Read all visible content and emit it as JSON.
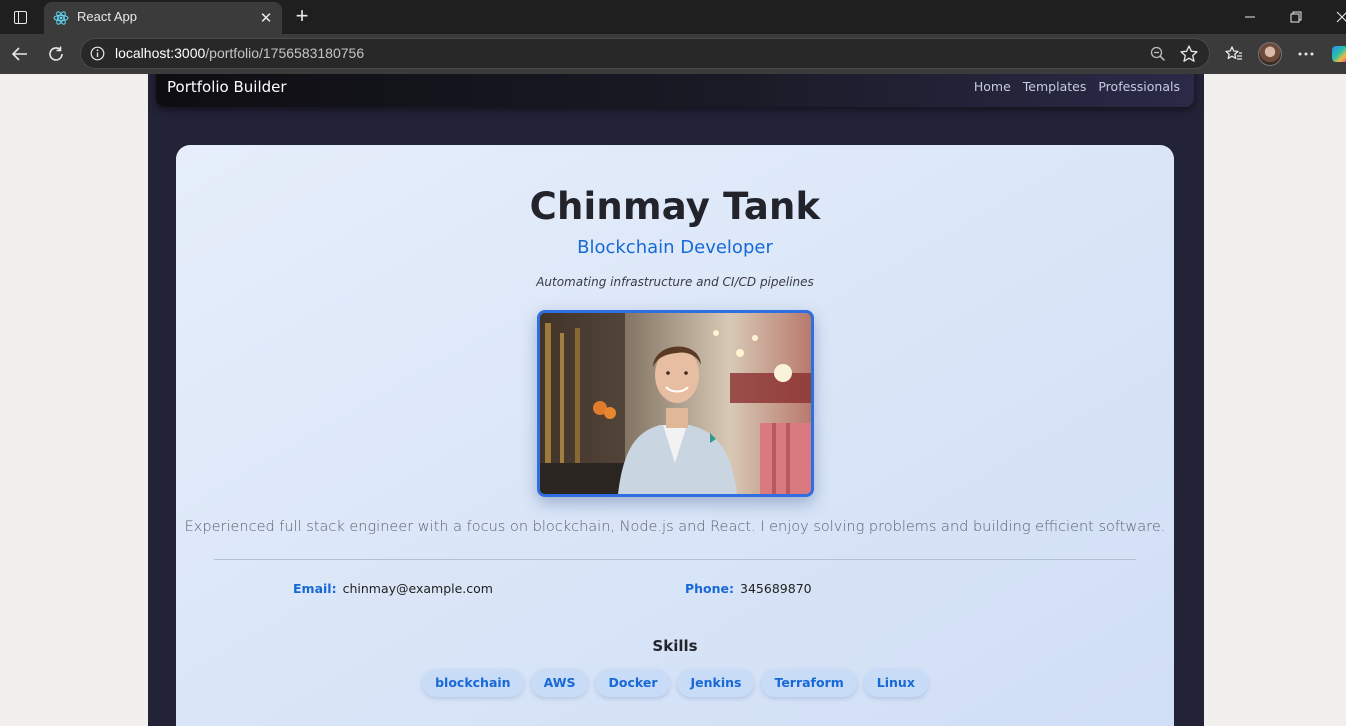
{
  "browser": {
    "tab_title": "React App",
    "url_host": "localhost:3000",
    "url_path": "/portfolio/1756583180756"
  },
  "navbar": {
    "brand": "Portfolio Builder",
    "links": [
      "Home",
      "Templates",
      "Professionals"
    ]
  },
  "profile": {
    "name": "Chinmay Tank",
    "role": "Blockchain Developer",
    "tagline": "Automating infrastructure and CI/CD pipelines",
    "bio": "Experienced full stack engineer with a focus on blockchain, Node.js and React. I enjoy solving problems and building efficient software.",
    "email_label": "Email:",
    "email": "chinmay@example.com",
    "phone_label": "Phone:",
    "phone": "345689870"
  },
  "skills": {
    "title": "Skills",
    "items": [
      "blockchain",
      "AWS",
      "Docker",
      "Jenkins",
      "Terraform",
      "Linux"
    ]
  },
  "colors": {
    "accent": "#1769d6",
    "page_bg": "#232338",
    "card_bg": "#e2ebfa"
  }
}
